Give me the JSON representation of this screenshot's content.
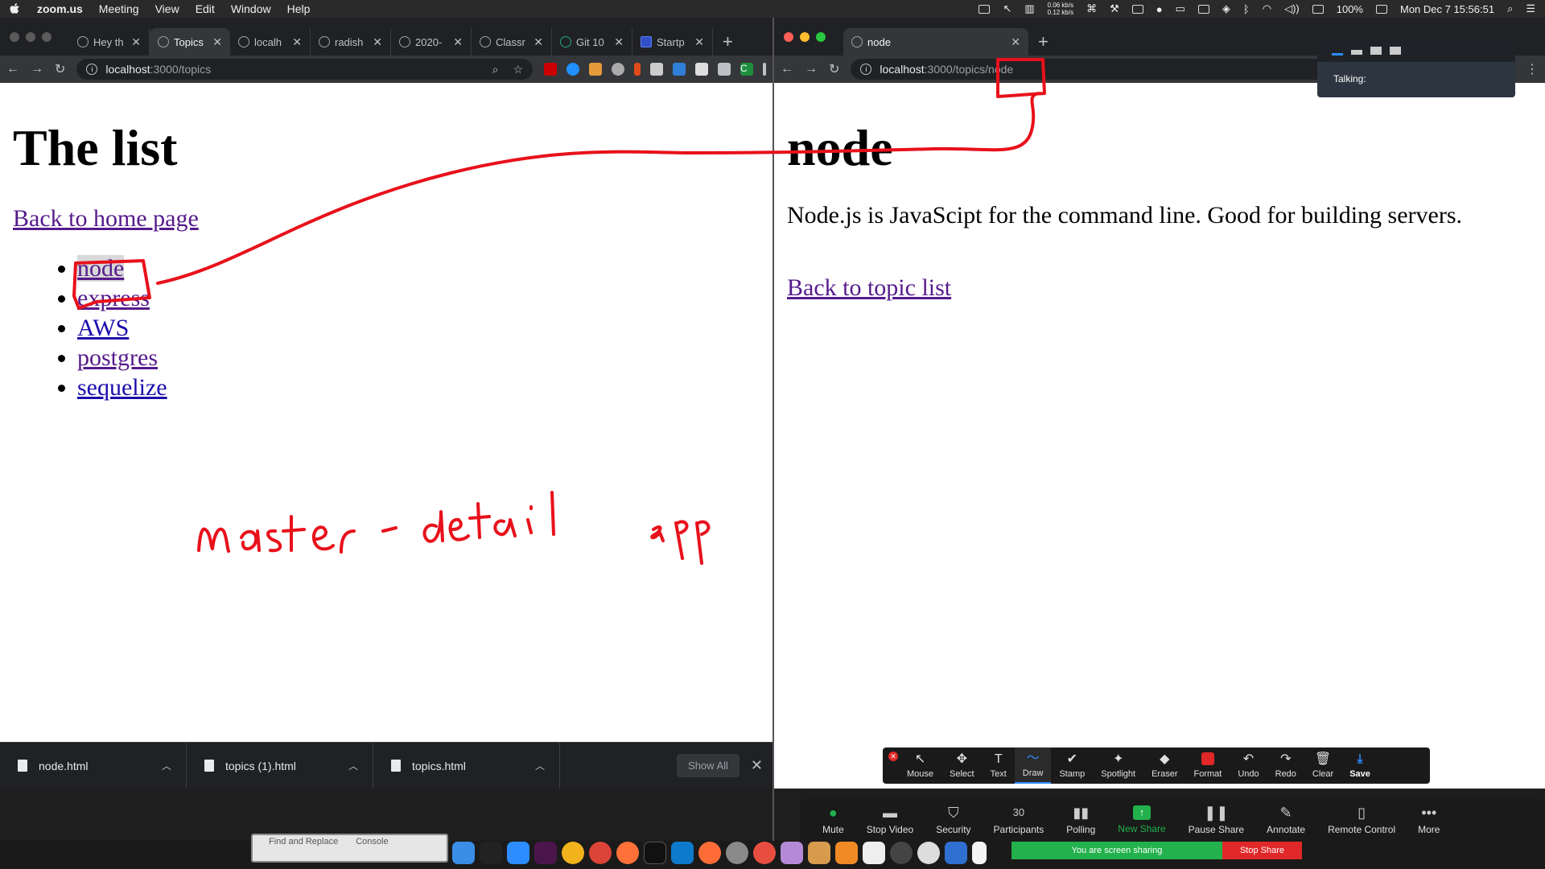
{
  "menubar": {
    "app": "zoom.us",
    "items": [
      "Meeting",
      "View",
      "Edit",
      "Window",
      "Help"
    ],
    "net_up": "0.06 kb/s",
    "net_down": "0.12 kb/s",
    "battery": "100%",
    "datetime": "Mon Dec 7  15:56:51"
  },
  "left_browser": {
    "tabs": [
      {
        "label": "Hey th"
      },
      {
        "label": "Topics"
      },
      {
        "label": "localh"
      },
      {
        "label": "radish"
      },
      {
        "label": "2020-"
      },
      {
        "label": "Classr"
      },
      {
        "label": "Git 10"
      },
      {
        "label": "Startp"
      }
    ],
    "url_host": "localhost",
    "url_path": ":3000/topics",
    "avatar_letter": "C",
    "page": {
      "heading": "The list",
      "back_link": "Back to home page",
      "topics": [
        "node",
        "express",
        "AWS",
        "postgres",
        "sequelize"
      ]
    },
    "downloads": [
      {
        "name": "node.html"
      },
      {
        "name": "topics (1).html"
      },
      {
        "name": "topics.html"
      }
    ],
    "show_all": "Show All"
  },
  "right_browser": {
    "tab_label": "node",
    "url_host": "localhost",
    "url_path": ":3000/topics/node",
    "page": {
      "heading": "node",
      "description": "Node.js is JavaScipt for the command line. Good for building servers.",
      "back_link": "Back to topic list"
    }
  },
  "talking_panel": {
    "label": "Talking:"
  },
  "annotation_annotation_text": "master-detail app",
  "annotate_toolbar": {
    "tools": [
      {
        "icon": "mouse-icon",
        "glyph": "↖",
        "label": "Mouse"
      },
      {
        "icon": "select-icon",
        "glyph": "✥",
        "label": "Select"
      },
      {
        "icon": "text-icon",
        "glyph": "T",
        "label": "Text"
      },
      {
        "icon": "draw-icon",
        "glyph": "〜",
        "label": "Draw"
      },
      {
        "icon": "stamp-icon",
        "glyph": "✔",
        "label": "Stamp"
      },
      {
        "icon": "spotlight-icon",
        "glyph": "✦",
        "label": "Spotlight"
      },
      {
        "icon": "eraser-icon",
        "glyph": "◆",
        "label": "Eraser"
      },
      {
        "icon": "format-icon",
        "glyph": "",
        "label": "Format"
      },
      {
        "icon": "undo-icon",
        "glyph": "↶",
        "label": "Undo"
      },
      {
        "icon": "redo-icon",
        "glyph": "↷",
        "label": "Redo"
      },
      {
        "icon": "clear-icon",
        "glyph": "🗑",
        "label": "Clear"
      },
      {
        "icon": "save-icon",
        "glyph": "⤓",
        "label": "Save"
      }
    ]
  },
  "zoom_controls": {
    "buttons": [
      {
        "icon": "mic-icon",
        "glyph": "🎙",
        "label": "Mute"
      },
      {
        "icon": "video-icon",
        "glyph": "▬",
        "label": "Stop Video"
      },
      {
        "icon": "shield-icon",
        "glyph": "⛉",
        "label": "Security"
      },
      {
        "icon": "participants-icon",
        "glyph": "👥",
        "label": "Participants",
        "count": "30"
      },
      {
        "icon": "polling-icon",
        "glyph": "▮▮",
        "label": "Polling"
      },
      {
        "icon": "new-share-icon",
        "glyph": "↑",
        "label": "New Share"
      },
      {
        "icon": "pause-icon",
        "glyph": "❚❚",
        "label": "Pause Share"
      },
      {
        "icon": "annotate-icon",
        "glyph": "✎",
        "label": "Annotate"
      },
      {
        "icon": "remote-control-icon",
        "glyph": "▯",
        "label": "Remote Control"
      },
      {
        "icon": "more-icon",
        "glyph": "•••",
        "label": "More"
      }
    ],
    "sharing_text": "You are screen sharing",
    "stop_share": "Stop Share"
  },
  "dock_box": {
    "find_replace": "Find and Replace",
    "console": "Console"
  },
  "colors": {
    "annotation_red": "#e8111b",
    "zoom_green": "#22b14c",
    "link_blue": "#1a0dab",
    "link_visited": "#551a8b"
  }
}
